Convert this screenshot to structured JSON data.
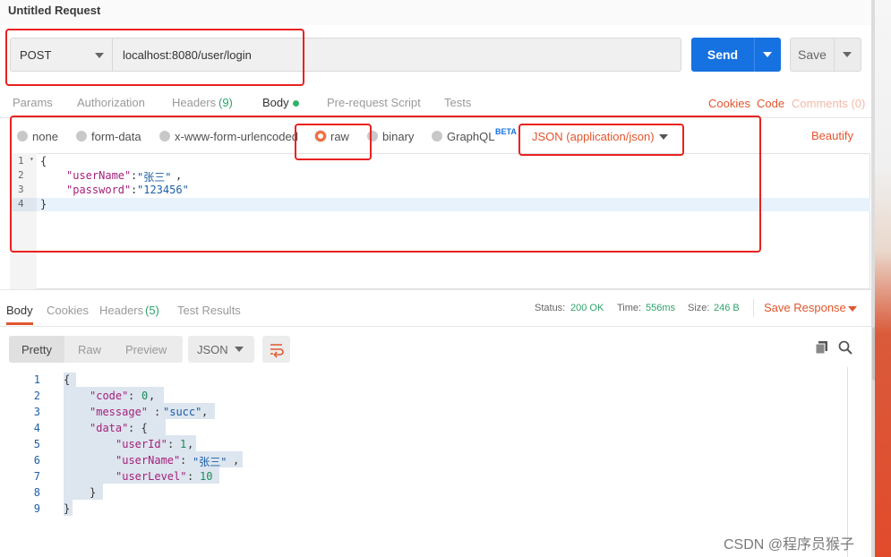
{
  "window": {
    "title": "Untitled Request"
  },
  "request": {
    "method": "POST",
    "url": "localhost:8080/user/login",
    "send_label": "Send",
    "save_label": "Save"
  },
  "request_tabs": {
    "params": "Params",
    "authorization": "Authorization",
    "headers": "Headers",
    "headers_count": "(9)",
    "body": "Body",
    "prerequest": "Pre-request Script",
    "tests": "Tests",
    "cookies": "Cookies",
    "code": "Code",
    "comments": "Comments (0)"
  },
  "body_types": {
    "none": "none",
    "form_data": "form-data",
    "urlencoded": "x-www-form-urlencoded",
    "raw": "raw",
    "binary": "binary",
    "graphql": "GraphQL",
    "beta": "BETA",
    "content_type": "JSON (application/json)",
    "beautify": "Beautify",
    "selected": "raw"
  },
  "request_body": {
    "line_numbers": [
      "1",
      "2",
      "3",
      "4"
    ],
    "line1": "{",
    "key1": "\"userName\"",
    "val1": "\"张三\"",
    "key2": "\"password\"",
    "val2": "\"123456\"",
    "line4": "}"
  },
  "response_tabs": {
    "body": "Body",
    "cookies": "Cookies",
    "headers": "Headers",
    "headers_count": "(5)",
    "test_results": "Test Results"
  },
  "response_status": {
    "status_label": "Status:",
    "status_value": "200 OK",
    "time_label": "Time:",
    "time_value": "556ms",
    "size_label": "Size:",
    "size_value": "246 B",
    "save_response": "Save Response"
  },
  "response_view": {
    "pretty": "Pretty",
    "raw": "Raw",
    "preview": "Preview",
    "format": "JSON"
  },
  "response_body": {
    "line_numbers": [
      "1",
      "2",
      "3",
      "4",
      "5",
      "6",
      "7",
      "8",
      "9"
    ],
    "open": "{",
    "code_key": "\"code\"",
    "code_val": "0",
    "message_key": "\"message\"",
    "message_val": "\"succ\"",
    "data_key": "\"data\"",
    "userid_key": "\"userId\"",
    "userid_val": "1",
    "username_key": "\"userName\"",
    "username_val": "\"张三\"",
    "userlevel_key": "\"userLevel\"",
    "userlevel_val": "10",
    "inner_close": "}",
    "close": "}"
  },
  "watermark": "CSDN @程序员猴子",
  "colors": {
    "accent_orange": "#e0562e",
    "send_blue": "#1672e0",
    "success_green": "#2fa36b",
    "annotation_red": "#e8221f"
  }
}
